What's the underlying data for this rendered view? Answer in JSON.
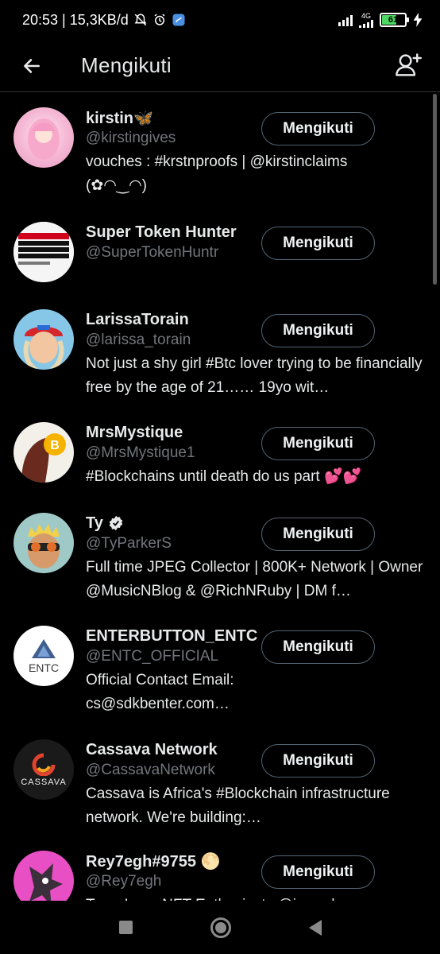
{
  "status_bar": {
    "time_speed": "20:53 | 15,3KB/d",
    "network": "4G",
    "battery": "61"
  },
  "header": {
    "title": "Mengikuti"
  },
  "accounts": [
    {
      "name": "kirstin🦋",
      "handle": "@kirstingives",
      "bio": "vouches : #krstnproofs | @kirstinclaims (✿◠‿◠)",
      "button": "Mengikuti",
      "avatar_label": ""
    },
    {
      "name": "Super Token Hunter",
      "handle": "@SuperTokenHuntr",
      "bio": "",
      "button": "Mengikuti",
      "avatar_label": "STOP OVER TRADING IMPULSE TRADING MISSING TRADES & BREAKING RULES"
    },
    {
      "name": "LarissaTorain",
      "handle": "@larissa_torain",
      "bio": "Not just a shy girl #Btc lover trying to be financially free by the age of 21…… 19yo wit…",
      "button": "Mengikuti",
      "avatar_label": ""
    },
    {
      "name": "MrsMystique",
      "handle": "@MrsMystique1",
      "bio": "#Blockchains until death do us part 💕💕",
      "button": "Mengikuti",
      "avatar_label": "B"
    },
    {
      "name": "Ty",
      "handle": "@TyParkerS",
      "bio": "Full time JPEG Collector | 800K+ Network | Owner @MusicNBlog & @RichNRuby | DM f…",
      "button": "Mengikuti",
      "avatar_label": ""
    },
    {
      "name": "ENTERBUTTON_ENTC",
      "handle": "@ENTC_OFFICIAL",
      "bio": "Official Contact Email: cs@sdkbenter.com…",
      "button": "Mengikuti",
      "avatar_label": "ENTC"
    },
    {
      "name": "Cassava Network",
      "handle": "@CassavaNetwork",
      "bio": "Cassava is Africa's #Blockchain infrastructure network. We're building:…",
      "button": "Mengikuti",
      "avatar_label": "CASSAVA"
    },
    {
      "name": "Rey7egh#9755 🌕",
      "handle": "@Rey7egh",
      "bio": "Terra Luna NFT Enthusiasts @jpeardas",
      "button": "Mengikuti",
      "avatar_label": ""
    }
  ]
}
